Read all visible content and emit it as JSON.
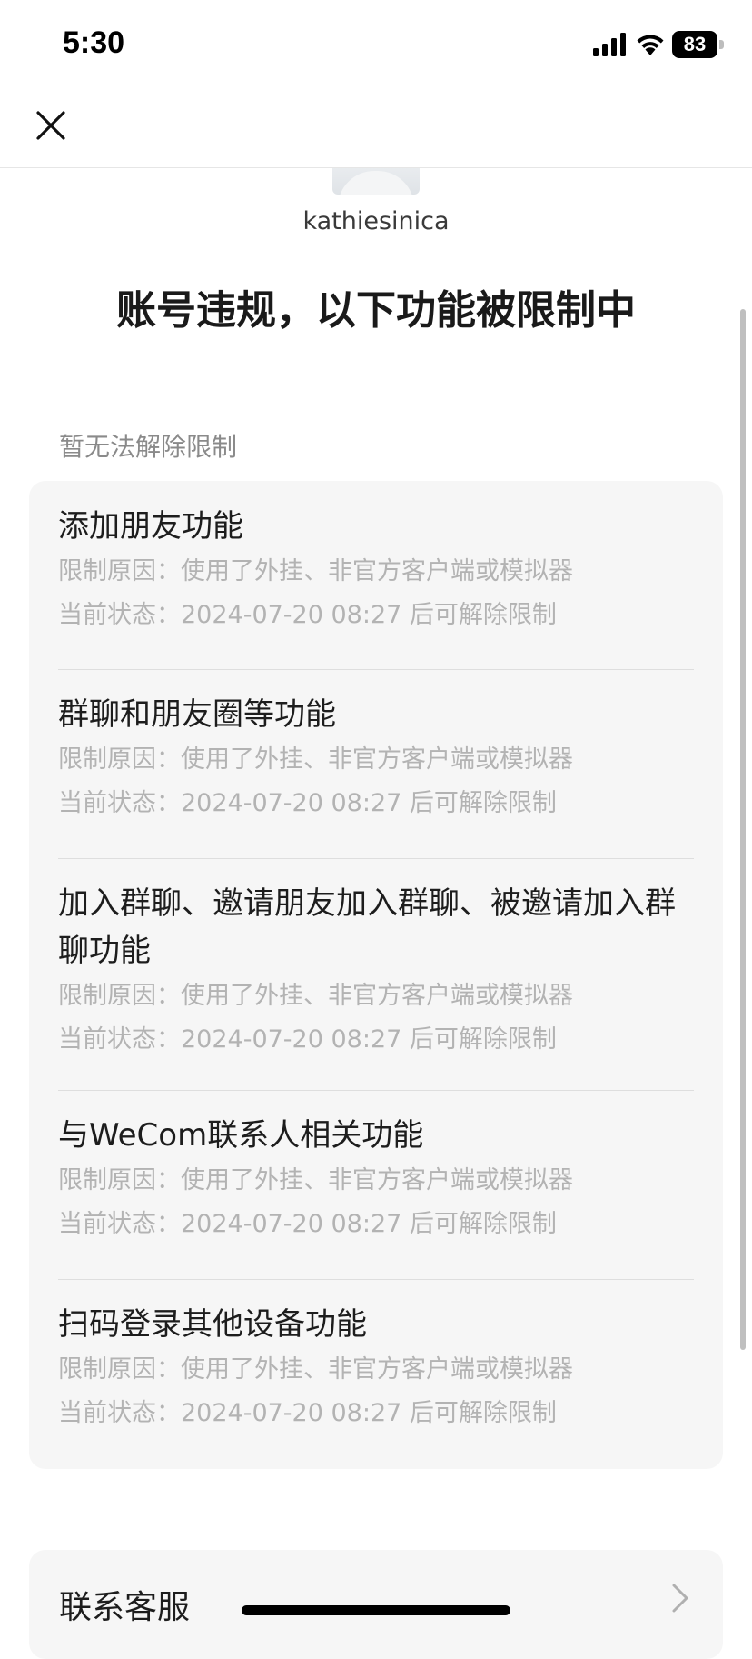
{
  "status_bar": {
    "time": "5:30",
    "battery": "83"
  },
  "nav": {
    "close_icon": "close-icon"
  },
  "profile": {
    "username": "kathiesinica"
  },
  "page_title": "账号违规，以下功能被限制中",
  "section_label": "暂无法解除限制",
  "restrictions": [
    {
      "title": "添加朋友功能",
      "reason": "限制原因：使用了外挂、非官方客户端或模拟器",
      "status": "当前状态：2024-07-20 08:27 后可解除限制"
    },
    {
      "title": "群聊和朋友圈等功能",
      "reason": "限制原因：使用了外挂、非官方客户端或模拟器",
      "status": "当前状态：2024-07-20 08:27 后可解除限制"
    },
    {
      "title": "加入群聊、邀请朋友加入群聊、被邀请加入群聊功能",
      "reason": "限制原因：使用了外挂、非官方客户端或模拟器",
      "status": "当前状态：2024-07-20 08:27 后可解除限制"
    },
    {
      "title": "与WeCom联系人相关功能",
      "reason": "限制原因：使用了外挂、非官方客户端或模拟器",
      "status": "当前状态：2024-07-20 08:27 后可解除限制"
    },
    {
      "title": "扫码登录其他设备功能",
      "reason": "限制原因：使用了外挂、非官方客户端或模拟器",
      "status": "当前状态：2024-07-20 08:27 后可解除限制"
    }
  ],
  "support": {
    "label": "联系客服"
  },
  "colors": {
    "card_bg": "#f6f6f6",
    "muted_text": "#b3b3b3",
    "label_text": "#8a8a8a"
  }
}
